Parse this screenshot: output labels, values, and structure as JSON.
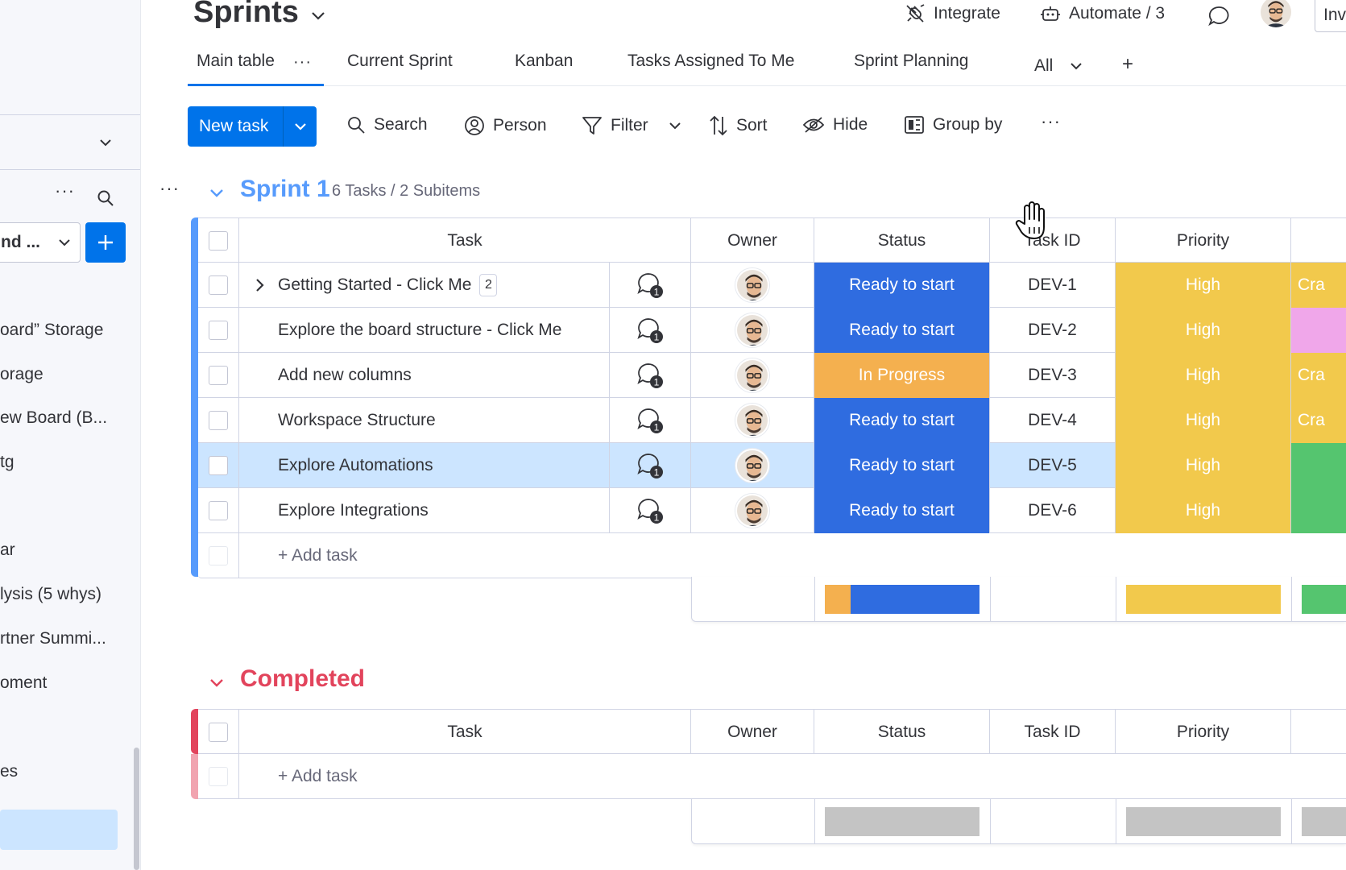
{
  "colors": {
    "primary": "#0073ea",
    "sprint_group": "#579bfc",
    "completed_group": "#e2445c",
    "ready_to_start": "#2f6ce0",
    "in_progress": "#f4b04f",
    "high": "#f2c94c",
    "green": "#55c56f",
    "pink": "#f0a7ea",
    "done_placeholder": "#c4c4c4"
  },
  "sidebar": {
    "workspace": "nd ...",
    "items": [
      {
        "label": "oard” Storage"
      },
      {
        "label": "orage"
      },
      {
        "label": "ew Board (B..."
      },
      {
        "label": "tg"
      },
      {
        "label": "ar"
      },
      {
        "label": "lysis (5 whys)"
      },
      {
        "label": "rtner Summi..."
      },
      {
        "label": "oment"
      },
      {
        "label": "es"
      }
    ]
  },
  "header": {
    "title": "Sprints",
    "integrate": "Integrate",
    "automate": "Automate / 3",
    "invite": "Inv"
  },
  "tabs": [
    {
      "label": "Main table"
    },
    {
      "label": "Current Sprint"
    },
    {
      "label": "Kanban"
    },
    {
      "label": "Tasks Assigned To Me"
    },
    {
      "label": "Sprint Planning"
    },
    {
      "label": "All"
    }
  ],
  "tab_add": "+",
  "toolbar": {
    "new_task": "New task",
    "search": "Search",
    "person": "Person",
    "filter": "Filter",
    "sort": "Sort",
    "hide": "Hide",
    "group_by": "Group by"
  },
  "columns": {
    "task": "Task",
    "owner": "Owner",
    "status": "Status",
    "task_id": "Task ID",
    "priority": "Priority"
  },
  "groups": [
    {
      "title": "Sprint 1",
      "count": "6 Tasks / 2 Subitems",
      "add_task": "+ Add task",
      "rows": [
        {
          "task": "Getting Started - Click Me",
          "subitems": "2",
          "updates": "1",
          "status": "Ready to start",
          "status_color": "#2f6ce0",
          "task_id": "DEV-1",
          "priority": "High",
          "extra": "Cra",
          "extra_color": "#f2c94c",
          "selected": false
        },
        {
          "task": "Explore the board structure - Click Me",
          "subitems": "",
          "updates": "1",
          "status": "Ready to start",
          "status_color": "#2f6ce0",
          "task_id": "DEV-2",
          "priority": "High",
          "extra": "",
          "extra_color": "#f0a7ea",
          "selected": false
        },
        {
          "task": "Add new columns",
          "subitems": "",
          "updates": "1",
          "status": "In Progress",
          "status_color": "#f4b04f",
          "task_id": "DEV-3",
          "priority": "High",
          "extra": "Cra",
          "extra_color": "#f2c94c",
          "selected": false
        },
        {
          "task": "Workspace Structure",
          "subitems": "",
          "updates": "1",
          "status": "Ready to start",
          "status_color": "#2f6ce0",
          "task_id": "DEV-4",
          "priority": "High",
          "extra": "Cra",
          "extra_color": "#f2c94c",
          "selected": false
        },
        {
          "task": "Explore Automations",
          "subitems": "",
          "updates": "1",
          "status": "Ready to start",
          "status_color": "#2f6ce0",
          "task_id": "DEV-5",
          "priority": "High",
          "extra": "",
          "extra_color": "#55c56f",
          "selected": true
        },
        {
          "task": "Explore Integrations",
          "subitems": "",
          "updates": "1",
          "status": "Ready to start",
          "status_color": "#2f6ce0",
          "task_id": "DEV-6",
          "priority": "High",
          "extra": "",
          "extra_color": "#55c56f",
          "selected": false
        }
      ]
    },
    {
      "title": "Completed",
      "count": "",
      "add_task": "+ Add task",
      "rows": []
    }
  ]
}
